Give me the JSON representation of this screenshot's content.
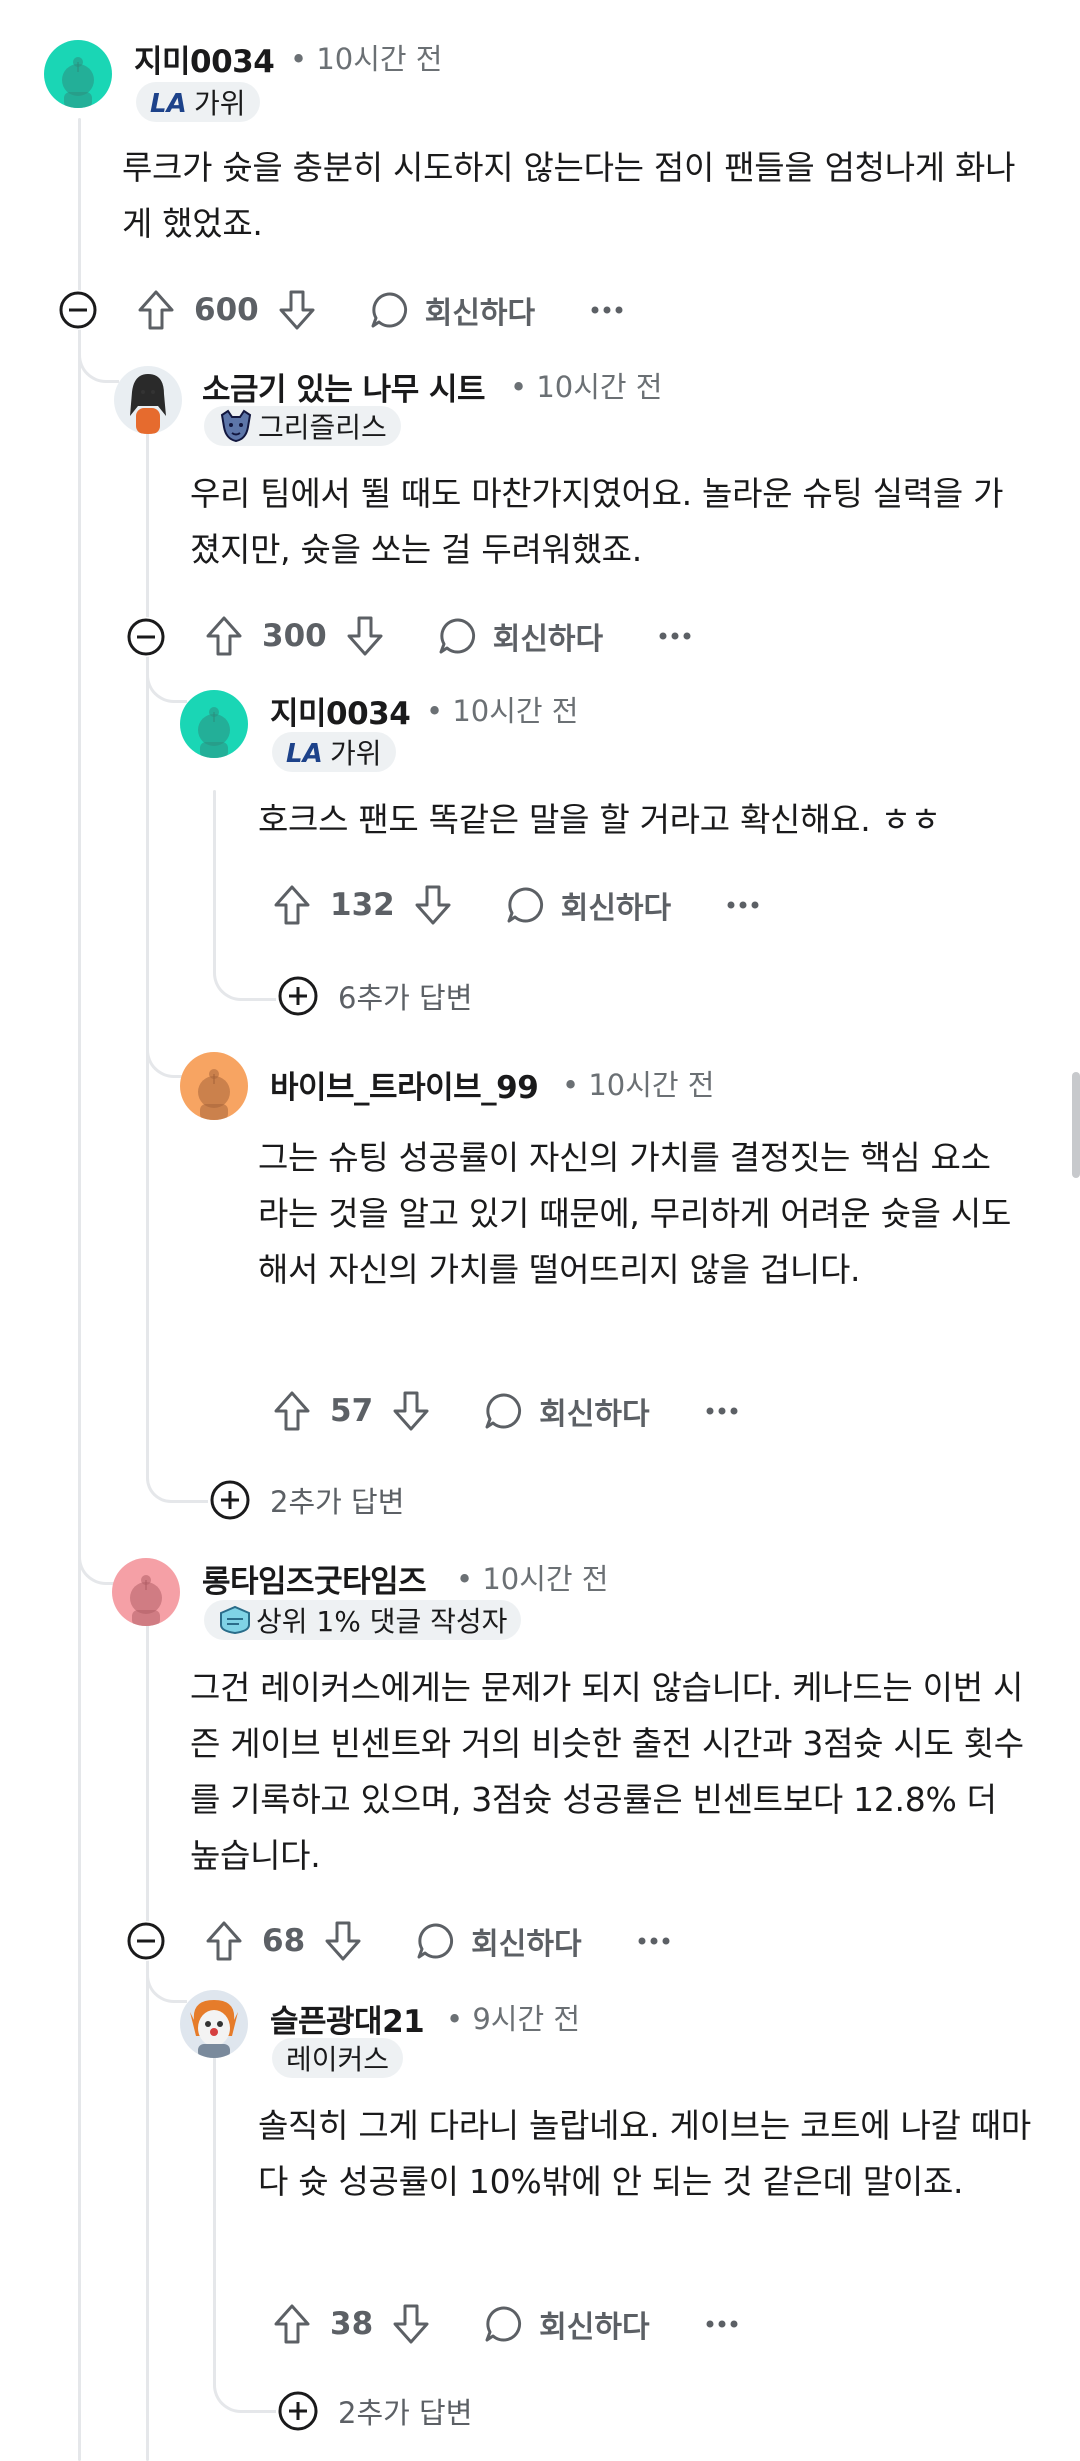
{
  "comments": [
    {
      "username": "지미0034",
      "time": "• 10시간 전",
      "flair": "가위",
      "flair_icon": "la-clippers-logo",
      "body": "루크가 슛을 충분히 시도하지 않는다는 점이 팬들을 엄청나게 화나게 했었죠.",
      "score": "600",
      "reply_label": "회신하다"
    },
    {
      "username": "소금기 있는 나무 시트",
      "time": "• 10시간 전",
      "flair": "그리즐리스",
      "flair_icon": "grizzlies-logo",
      "body": "우리 팀에서 뛸 때도 마찬가지였어요. 놀라운 슈팅 실력을 가졌지만, 슛을 쏘는 걸 두려워했죠.",
      "score": "300",
      "reply_label": "회신하다"
    },
    {
      "username": "지미0034",
      "time": "• 10시간 전",
      "flair": "가위",
      "flair_icon": "la-clippers-logo",
      "body": "호크스 팬도 똑같은 말을 할 거라고 확신해요. ㅎㅎ",
      "score": "132",
      "reply_label": "회신하다",
      "more_replies": "6추가 답변"
    },
    {
      "username": "바이브_트라이브_99",
      "time": "• 10시간 전",
      "body": "그는 슈팅 성공률이 자신의 가치를 결정짓는 핵심 요소라는 것을 알고 있기 때문에, 무리하게 어려운 슛을 시도해서 자신의 가치를 떨어뜨리지 않을 겁니다.",
      "score": "57",
      "reply_label": "회신하다",
      "more_replies": "2추가 답변"
    },
    {
      "username": "롱타임즈굿타임즈",
      "time": "• 10시간 전",
      "flair": "상위 1% 댓글 작성자",
      "flair_icon": "top-commenter-badge",
      "body": "그건 레이커스에게는 문제가 되지 않습니다. 케나드는 이번 시즌 게이브 빈센트와 거의 비슷한 출전 시간과 3점슛 시도 횟수를 기록하고 있으며, 3점슛 성공률은 빈센트보다 12.8% 더 높습니다.",
      "score": "68",
      "reply_label": "회신하다"
    },
    {
      "username": "슬픈광대21",
      "time": "• 9시간 전",
      "flair": "레이커스",
      "body": "솔직히 그게 다라니 놀랍네요. 게이브는 코트에 나갈 때마다 슛 성공률이 10%밖에 안 되는 것 같은데 말이죠.",
      "score": "38",
      "reply_label": "회신하다",
      "more_replies": "2추가 답변"
    }
  ],
  "colors": {
    "snoo_teal": "#1ad6b5",
    "snoo_orange": "#f7a462",
    "snoo_pink": "#f5a0a6",
    "thread_line": "#e5e7ea",
    "flair_bg": "#eef1f3",
    "meta_text": "#6b7074"
  }
}
